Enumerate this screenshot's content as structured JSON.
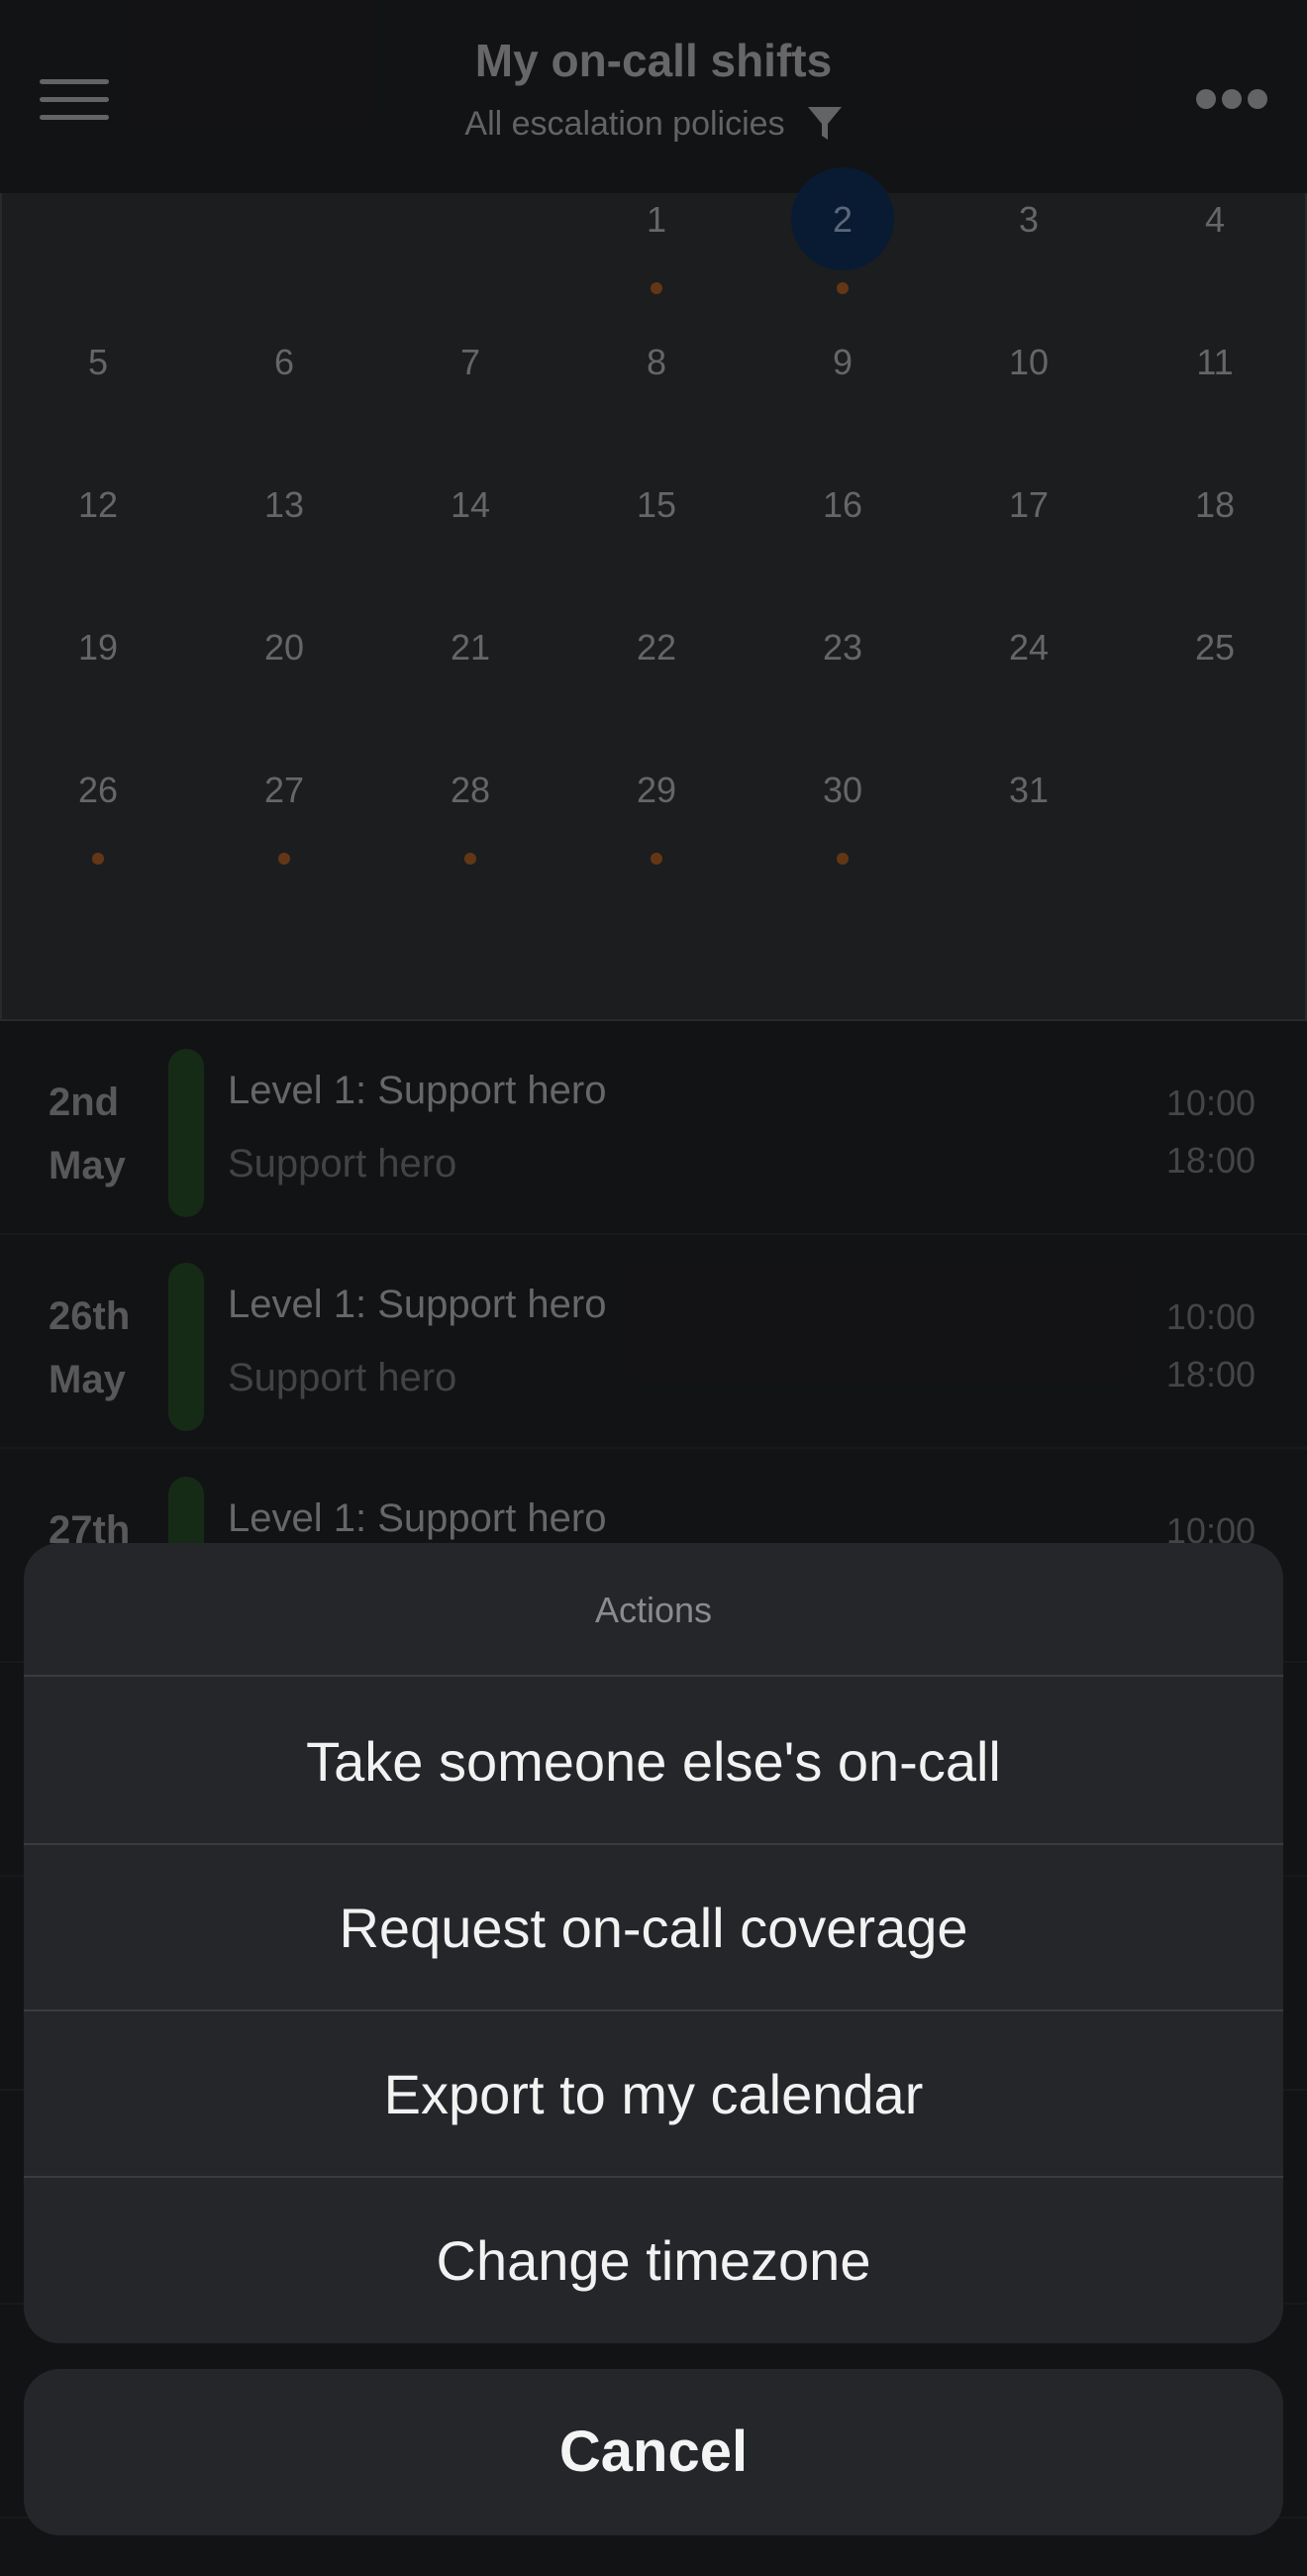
{
  "header": {
    "title": "My on-call shifts",
    "subtitle": "All escalation policies",
    "menu_icon": "hamburger-menu-icon",
    "filter_icon": "filter-funnel-icon",
    "more_icon": "more-horizontal-icon"
  },
  "calendar": {
    "selected_day": "2",
    "selected_color": "#0d2547",
    "dot_color": "#8a4d1f",
    "days_with_shifts": [
      "1",
      "2",
      "26",
      "27",
      "28",
      "29",
      "30"
    ],
    "weeks": [
      [
        "",
        "",
        "",
        "1",
        "2",
        "3",
        "4"
      ],
      [
        "5",
        "6",
        "7",
        "8",
        "9",
        "10",
        "11"
      ],
      [
        "12",
        "13",
        "14",
        "15",
        "16",
        "17",
        "18"
      ],
      [
        "19",
        "20",
        "21",
        "22",
        "23",
        "24",
        "25"
      ],
      [
        "26",
        "27",
        "28",
        "29",
        "30",
        "31",
        ""
      ]
    ]
  },
  "shifts": [
    {
      "day": "2nd",
      "month": "May",
      "title": "Level 1: Support hero",
      "subtitle": "Support hero",
      "start": "10:00",
      "end": "18:00"
    },
    {
      "day": "26th",
      "month": "May",
      "title": "Level 1: Support hero",
      "subtitle": "Support hero",
      "start": "10:00",
      "end": "18:00"
    },
    {
      "day": "27th",
      "month": "",
      "title": "Level 1: Support hero",
      "subtitle": "",
      "start": "10:00",
      "end": ""
    }
  ],
  "action_sheet": {
    "title": "Actions",
    "buttons": [
      "Take someone else's on-call",
      "Request on-call coverage",
      "Export to my calendar",
      "Change timezone"
    ],
    "cancel_label": "Cancel"
  },
  "colors": {
    "shift_bar": "#1f3c1f",
    "background": "#1a1b1d"
  }
}
